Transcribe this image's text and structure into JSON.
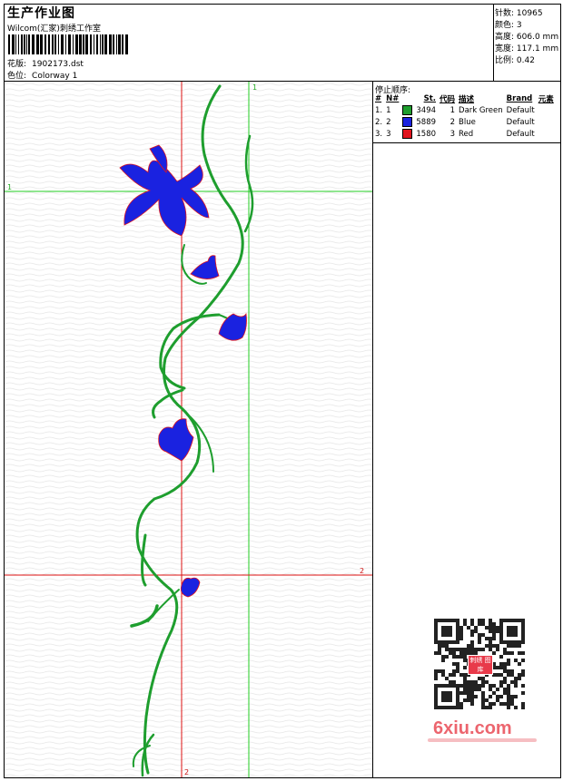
{
  "header": {
    "title": "生产作业图",
    "studio": "Wilcom(汇家)刺绣工作室",
    "pattern_label": "花版:",
    "pattern_value": "1902173.dst",
    "color_label": "色位:",
    "color_value": "Colorway 1"
  },
  "stats": [
    {
      "label": "针数:",
      "value": "10965"
    },
    {
      "label": "颜色:",
      "value": "3"
    },
    {
      "label": "高度:",
      "value": "606.0 mm"
    },
    {
      "label": "宽度:",
      "value": "117.1 mm"
    },
    {
      "label": "比例:",
      "value": "0.42"
    }
  ],
  "guides": {
    "v_green_label": "1",
    "h_green_label": "1",
    "h_red_label": "2",
    "v_red_label": "2"
  },
  "stop_sequence": {
    "title": "停止顺序:",
    "columns": [
      "#",
      "N#",
      "St.",
      "代码",
      "描述",
      "Brand",
      "元素"
    ],
    "rows": [
      {
        "num": "1.",
        "n": "1",
        "color": "#1e9e2e",
        "stitches": "3494",
        "code": "1",
        "desc": "Dark Green",
        "brand": "Default"
      },
      {
        "num": "2.",
        "n": "2",
        "color": "#1a22e0",
        "stitches": "5889",
        "code": "2",
        "desc": "Blue",
        "brand": "Default"
      },
      {
        "num": "3.",
        "n": "3",
        "color": "#e0141e",
        "stitches": "1580",
        "code": "3",
        "desc": "Red",
        "brand": "Default"
      }
    ]
  },
  "watermark": {
    "site": "6xiu.com",
    "badge": "刺绣 图库"
  },
  "colors": {
    "green_thread": "#1e9e2e",
    "blue_thread": "#1a22e0",
    "red_thread": "#e0141e",
    "guide_green": "#22cc22",
    "guide_red": "#dd1111"
  }
}
